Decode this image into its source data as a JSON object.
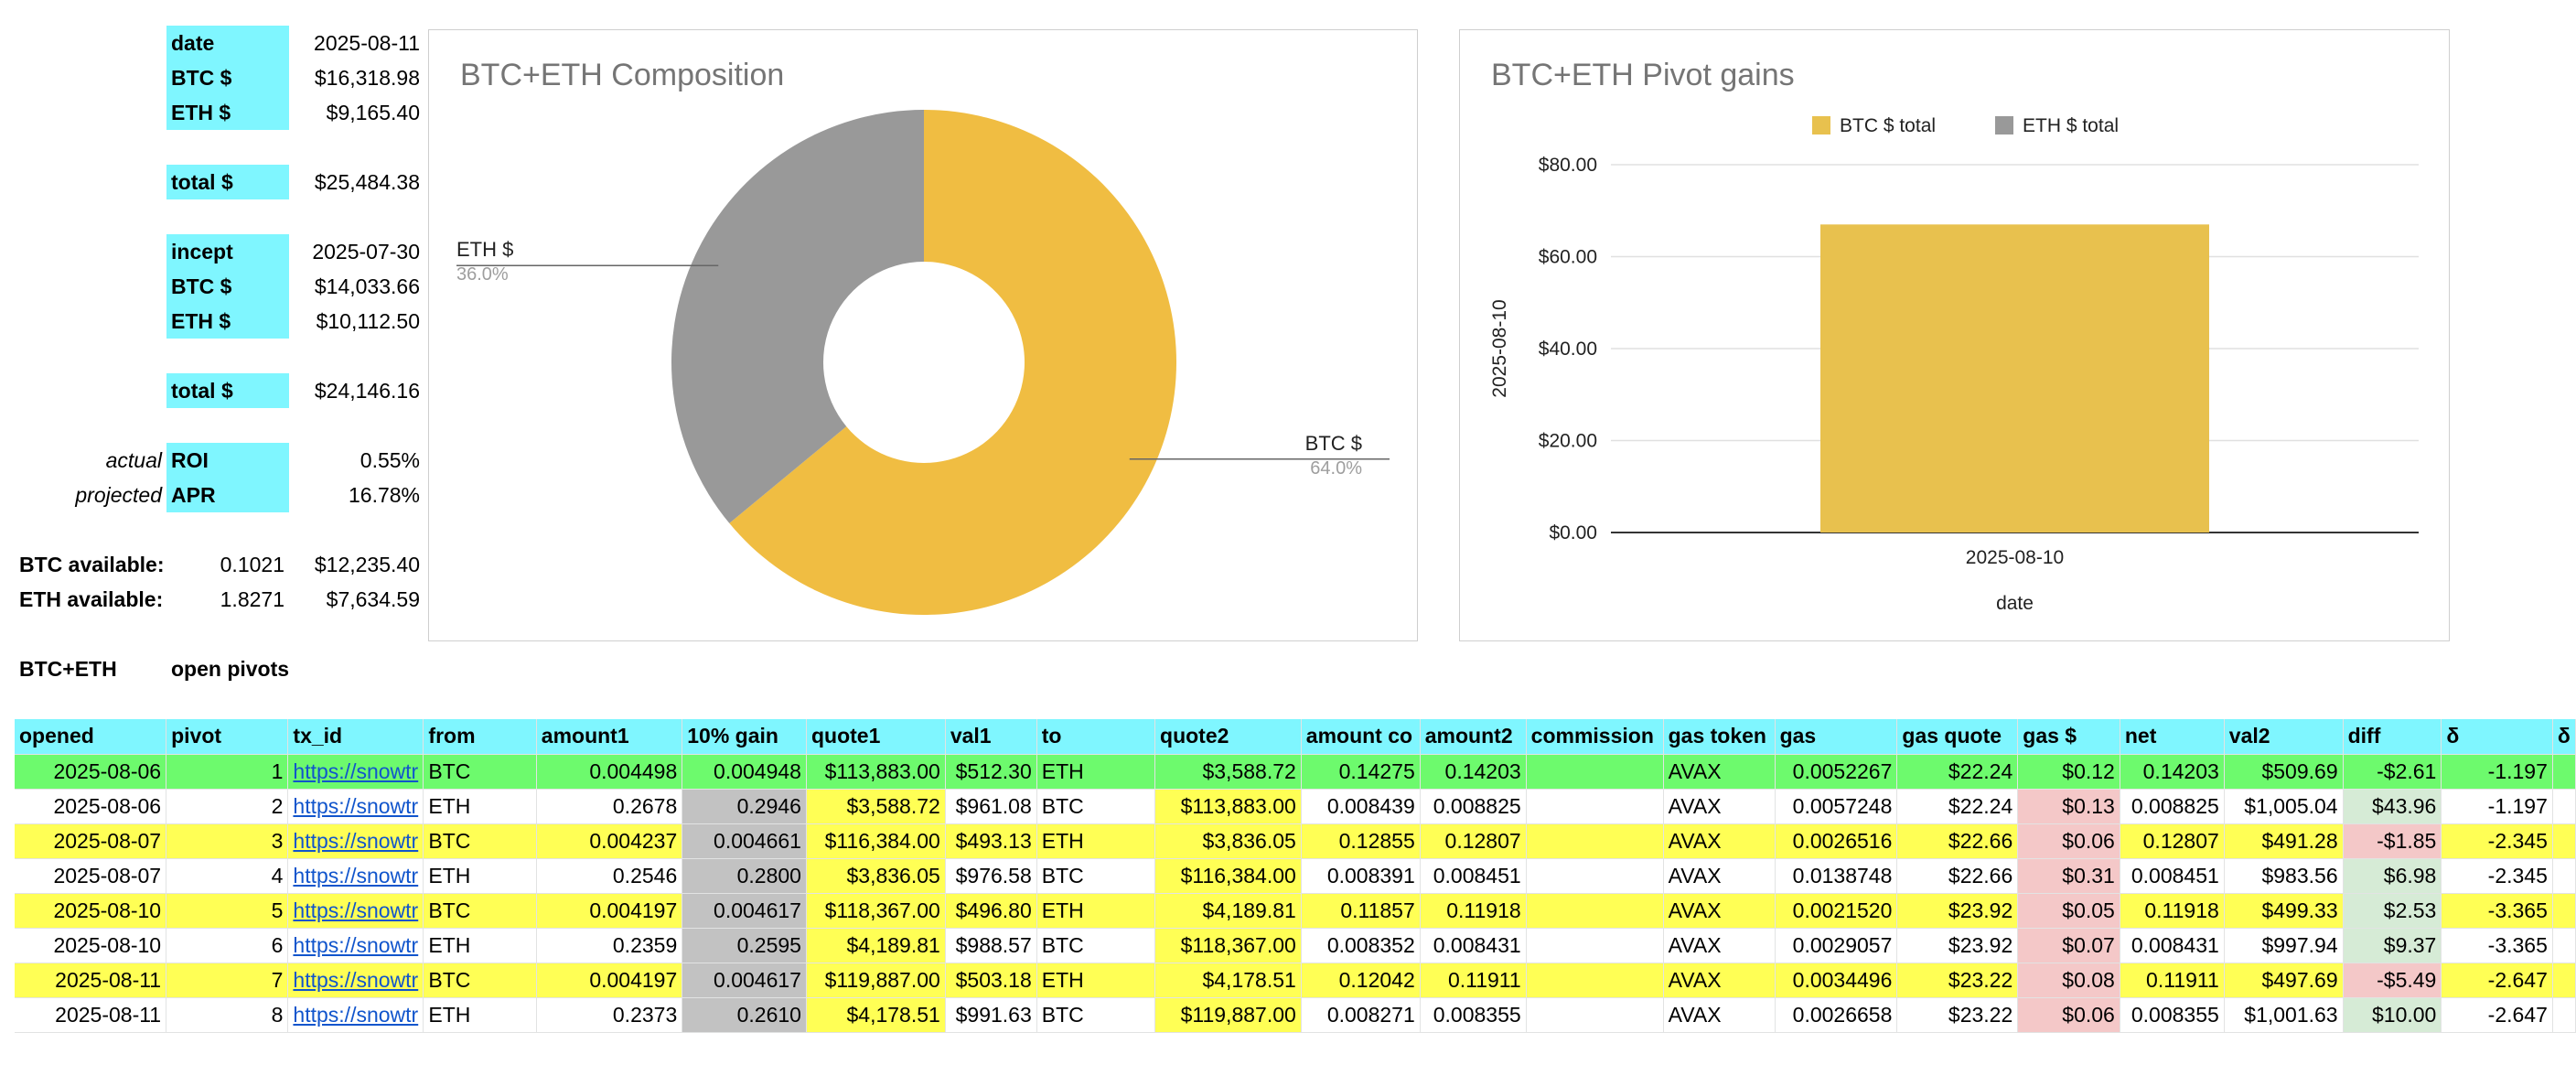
{
  "summary": {
    "date_label": "date",
    "date_value": "2025-08-11",
    "btc_label": "BTC $",
    "btc_value": "$16,318.98",
    "eth_label": "ETH $",
    "eth_value": "$9,165.40",
    "total_label": "total $",
    "total_value": "$25,484.38",
    "incept_label": "incept",
    "incept_value": "2025-07-30",
    "incept_btc_label": "BTC $",
    "incept_btc_value": "$14,033.66",
    "incept_eth_label": "ETH $",
    "incept_eth_value": "$10,112.50",
    "incept_total_label": "total $",
    "incept_total_value": "$24,146.16",
    "actual_label": "actual",
    "roi_label": "ROI",
    "roi_value": "0.55%",
    "projected_label": "projected",
    "apr_label": "APR",
    "apr_value": "16.78%",
    "btc_avail_label": "BTC available:",
    "btc_avail_qty": "0.1021",
    "btc_avail_usd": "$12,235.40",
    "eth_avail_label": "ETH available:",
    "eth_avail_qty": "1.8271",
    "eth_avail_usd": "$7,634.59",
    "section_label": "BTC+ETH",
    "open_pivots_label": "open pivots"
  },
  "colors": {
    "cyan": "#7ff6ff",
    "green": "#6dfa6d",
    "yellow": "#ffff55",
    "btc_slice": "#f0bd42",
    "eth_slice": "#999999",
    "bar": "#e8c14e"
  },
  "chart_data": [
    {
      "type": "pie",
      "title": "BTC+ETH Composition",
      "donut": true,
      "slices": [
        {
          "label": "BTC $",
          "pct": 64.0,
          "pct_label": "64.0%"
        },
        {
          "label": "ETH $",
          "pct": 36.0,
          "pct_label": "36.0%"
        }
      ]
    },
    {
      "type": "bar",
      "title": "BTC+ETH Pivot gains",
      "categories": [
        "2025-08-10"
      ],
      "series": [
        {
          "name": "BTC $ total",
          "values": [
            67
          ]
        },
        {
          "name": "ETH $ total",
          "values": [
            0
          ]
        }
      ],
      "xlabel": "date",
      "ylabel": "2025-08-10",
      "ylim": [
        0,
        80
      ],
      "yticks": [
        "$0.00",
        "$20.00",
        "$40.00",
        "$60.00",
        "$80.00"
      ],
      "legend": "top",
      "grid": true
    }
  ],
  "table": {
    "headers": [
      "opened",
      "pivot",
      "tx_id",
      "from",
      "amount1",
      "10% gain",
      "quote1",
      "val1",
      "to",
      "quote2",
      "amount co",
      "amount2",
      "commission",
      "gas token",
      "gas",
      "gas quote",
      "gas $",
      "net",
      "val2",
      "diff",
      "δ",
      "δ"
    ],
    "rows": [
      [
        "2025-08-06",
        "1",
        "https://snowtr",
        "BTC",
        "0.004498",
        "0.004948",
        "$113,883.00",
        "$512.30",
        "ETH",
        "$3,588.72",
        "0.14275",
        "0.14203",
        "",
        "AVAX",
        "0.0052267",
        "$22.24",
        "$0.12",
        "0.14203",
        "$509.69",
        "-$2.61",
        "-1.197",
        ""
      ],
      [
        "2025-08-06",
        "2",
        "https://snowtr",
        "ETH",
        "0.2678",
        "0.2946",
        "$3,588.72",
        "$961.08",
        "BTC",
        "$113,883.00",
        "0.008439",
        "0.008825",
        "",
        "AVAX",
        "0.0057248",
        "$22.24",
        "$0.13",
        "0.008825",
        "$1,005.04",
        "$43.96",
        "-1.197",
        ""
      ],
      [
        "2025-08-07",
        "3",
        "https://snowtr",
        "BTC",
        "0.004237",
        "0.004661",
        "$116,384.00",
        "$493.13",
        "ETH",
        "$3,836.05",
        "0.12855",
        "0.12807",
        "",
        "AVAX",
        "0.0026516",
        "$22.66",
        "$0.06",
        "0.12807",
        "$491.28",
        "-$1.85",
        "-2.345",
        ""
      ],
      [
        "2025-08-07",
        "4",
        "https://snowtr",
        "ETH",
        "0.2546",
        "0.2800",
        "$3,836.05",
        "$976.58",
        "BTC",
        "$116,384.00",
        "0.008391",
        "0.008451",
        "",
        "AVAX",
        "0.0138748",
        "$22.66",
        "$0.31",
        "0.008451",
        "$983.56",
        "$6.98",
        "-2.345",
        ""
      ],
      [
        "2025-08-10",
        "5",
        "https://snowtr",
        "BTC",
        "0.004197",
        "0.004617",
        "$118,367.00",
        "$496.80",
        "ETH",
        "$4,189.81",
        "0.11857",
        "0.11918",
        "",
        "AVAX",
        "0.0021520",
        "$23.92",
        "$0.05",
        "0.11918",
        "$499.33",
        "$2.53",
        "-3.365",
        ""
      ],
      [
        "2025-08-10",
        "6",
        "https://snowtr",
        "ETH",
        "0.2359",
        "0.2595",
        "$4,189.81",
        "$988.57",
        "BTC",
        "$118,367.00",
        "0.008352",
        "0.008431",
        "",
        "AVAX",
        "0.0029057",
        "$23.92",
        "$0.07",
        "0.008431",
        "$997.94",
        "$9.37",
        "-3.365",
        ""
      ],
      [
        "2025-08-11",
        "7",
        "https://snowtr",
        "BTC",
        "0.004197",
        "0.004617",
        "$119,887.00",
        "$503.18",
        "ETH",
        "$4,178.51",
        "0.12042",
        "0.11911",
        "",
        "AVAX",
        "0.0034496",
        "$23.22",
        "$0.08",
        "0.11911",
        "$497.69",
        "-$5.49",
        "-2.647",
        ""
      ],
      [
        "2025-08-11",
        "8",
        "https://snowtr",
        "ETH",
        "0.2373",
        "0.2610",
        "$4,178.51",
        "$991.63",
        "BTC",
        "$119,887.00",
        "0.008271",
        "0.008355",
        "",
        "AVAX",
        "0.0026658",
        "$23.22",
        "$0.06",
        "0.008355",
        "$1,001.63",
        "$10.00",
        "-2.647",
        ""
      ]
    ]
  }
}
